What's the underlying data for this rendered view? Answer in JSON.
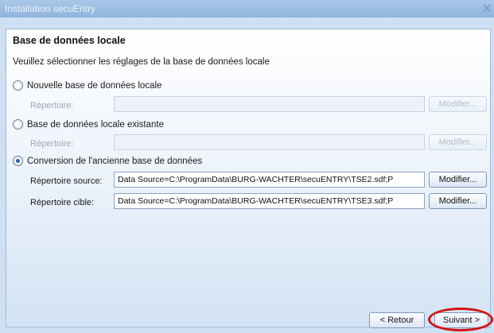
{
  "window": {
    "title": "Installation secuEntry"
  },
  "page": {
    "heading": "Base de données locale",
    "subtitle": "Veuillez sélectionner les réglages de la base de données locale"
  },
  "options": [
    {
      "label": "Nouvelle base de données locale",
      "checked": false,
      "fields": [
        {
          "label": "Répertoire:",
          "value": "",
          "button": "Modifier..."
        }
      ]
    },
    {
      "label": "Base de données locale existante",
      "checked": false,
      "fields": [
        {
          "label": "Répertoire:",
          "value": "",
          "button": "Modifier..."
        }
      ]
    },
    {
      "label": "Conversion de l'ancienne base de données",
      "checked": true,
      "fields": [
        {
          "label": "Répertoire source:",
          "value": "Data Source=C:\\ProgramData\\BURG-WACHTER\\secuENTRY\\TSE2.sdf;P",
          "button": "Modifier..."
        },
        {
          "label": "Répertoire cible:",
          "value": "Data Source=C:\\ProgramData\\BURG-WACHTER\\secuENTRY\\TSE3.sdf;P",
          "button": "Modifier..."
        }
      ]
    }
  ],
  "footer": {
    "back_label": "< Retour",
    "next_label": "Suivant >"
  },
  "icons": {
    "close": "close-icon"
  },
  "colors": {
    "highlight": "#d41313",
    "accent": "#2a62b8"
  }
}
